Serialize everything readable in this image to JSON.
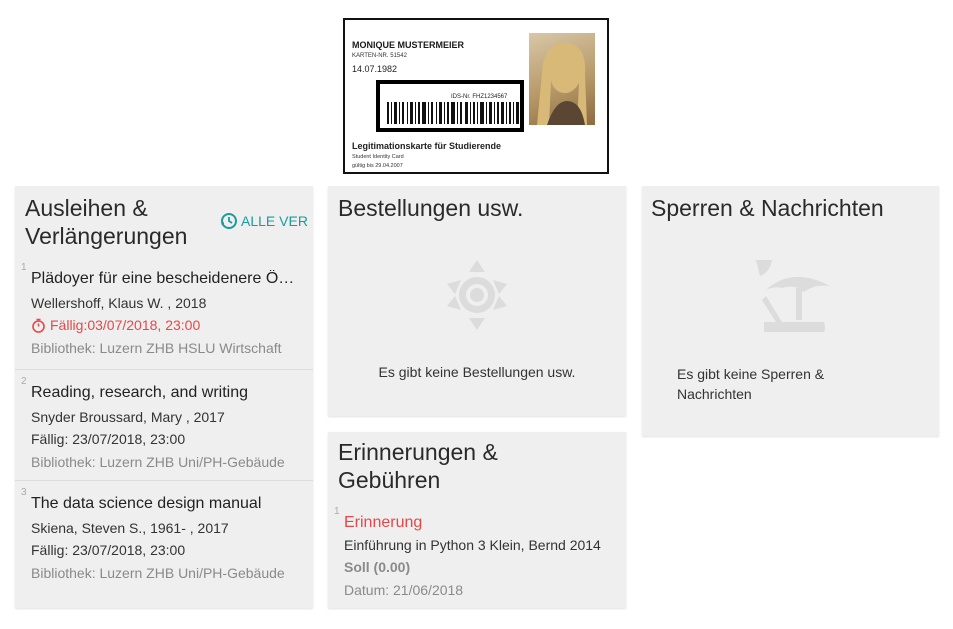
{
  "id_card": {
    "name": "MONIQUE MUSTERMEIER",
    "card_nr": "KARTEN-NR. 51542",
    "dob": "14.07.1982",
    "ids_nr": "IDS-Nr. FHZ1234567",
    "title": "Legitimationskarte für Studierende",
    "subtitle": "Student Identity Card",
    "valid": "gültig bis 29.04.2007"
  },
  "loans": {
    "title": "Ausleihen & Verlängerungen",
    "renew_all": "ALLE VER",
    "items": [
      {
        "num": "1",
        "title": "Plädoyer für eine bescheidenere Ö…",
        "author": "Wellershoff, Klaus W. , 2018",
        "due": "Fällig:03/07/2018, 23:00",
        "overdue": true,
        "library": "Bibliothek: Luzern ZHB HSLU Wirtschaft"
      },
      {
        "num": "2",
        "title": "Reading, research, and writing",
        "author": "Snyder Broussard, Mary , 2017",
        "due": "Fällig: 23/07/2018, 23:00",
        "overdue": false,
        "library": "Bibliothek: Luzern ZHB Uni/PH-Gebäude"
      },
      {
        "num": "3",
        "title": "The data science design manual",
        "author": "Skiena, Steven S., 1961- , 2017",
        "due": "Fällig: 23/07/2018, 23:00",
        "overdue": false,
        "library": "Bibliothek: Luzern ZHB Uni/PH-Gebäude"
      }
    ]
  },
  "requests": {
    "title": "Bestellungen usw.",
    "empty": "Es gibt keine Bestellungen usw."
  },
  "blocks": {
    "title": "Sperren & Nachrichten",
    "empty": "Es gibt keine Sperren & Nachrichten"
  },
  "fines": {
    "title": "Erinnerungen & Gebühren",
    "num": "1",
    "type": "Erinnerung",
    "desc": "Einführung in Python 3 Klein, Bernd 2014",
    "amount": "Soll (0.00)",
    "date": "Datum: 21/06/2018"
  },
  "colors": {
    "accent": "#1a9c9c",
    "overdue": "#e54848",
    "card_bg": "#efefef"
  }
}
